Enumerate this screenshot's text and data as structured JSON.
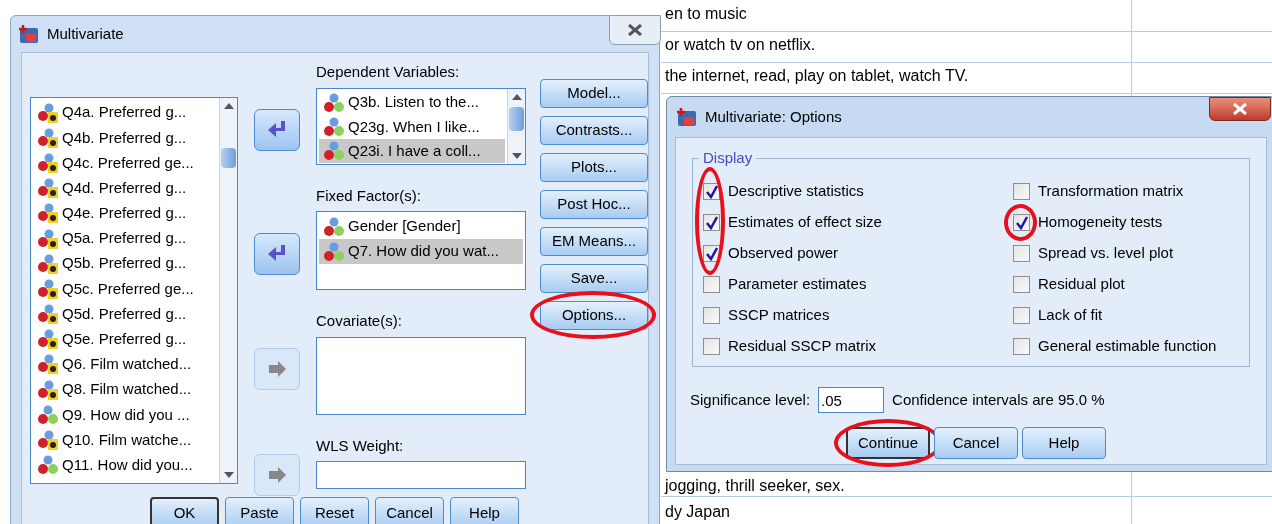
{
  "spreadsheet": {
    "rows": [
      {
        "text": "en to music"
      },
      {
        "text": "or watch tv on netflix."
      },
      {
        "text": "the internet, read, play on tablet, watch TV."
      },
      {
        "text": "jogging, thrill seeker, sex."
      },
      {
        "text": "dy Japan"
      }
    ]
  },
  "main_dialog": {
    "title": "Multivariate",
    "source_list": [
      {
        "label": "Q4a. Preferred g...",
        "kind": "string"
      },
      {
        "label": "Q4b. Preferred g...",
        "kind": "string"
      },
      {
        "label": "Q4c. Preferred ge...",
        "kind": "string"
      },
      {
        "label": "Q4d. Preferred g...",
        "kind": "string"
      },
      {
        "label": "Q4e. Preferred g...",
        "kind": "string"
      },
      {
        "label": "Q5a. Preferred g...",
        "kind": "string"
      },
      {
        "label": "Q5b. Preferred g...",
        "kind": "string"
      },
      {
        "label": "Q5c. Preferred ge...",
        "kind": "string"
      },
      {
        "label": "Q5d. Preferred g...",
        "kind": "string"
      },
      {
        "label": "Q5e. Preferred g...",
        "kind": "string"
      },
      {
        "label": "Q6. Film watched...",
        "kind": "string"
      },
      {
        "label": "Q8. Film watched...",
        "kind": "string"
      },
      {
        "label": "Q9. How did you ...",
        "kind": "numeric"
      },
      {
        "label": "Q10. Film watche...",
        "kind": "string"
      },
      {
        "label": "Q11. How did you...",
        "kind": "numeric"
      }
    ],
    "targets": [
      {
        "label": "Dependent Variables:",
        "arrow_disabled": false,
        "items": [
          {
            "label": "Q3b. Listen to the...",
            "kind": "numeric",
            "selected": false
          },
          {
            "label": "Q23g. When I like...",
            "kind": "numeric",
            "selected": false
          },
          {
            "label": "Q23i. I have a coll...",
            "kind": "numeric",
            "selected": true
          }
        ]
      },
      {
        "label": "Fixed Factor(s):",
        "arrow_disabled": false,
        "items": [
          {
            "label": "Gender   [Gender]",
            "kind": "numeric",
            "selected": false
          },
          {
            "label": "Q7. How did you wat...",
            "kind": "numeric",
            "selected": true
          }
        ]
      },
      {
        "label": "Covariate(s):",
        "arrow_disabled": true
      },
      {
        "label": "WLS Weight:",
        "arrow_disabled": true
      }
    ],
    "side_buttons": [
      {
        "label": "Model...",
        "circled": false
      },
      {
        "label": "Contrasts...",
        "circled": false
      },
      {
        "label": "Plots...",
        "circled": false
      },
      {
        "label": "Post Hoc...",
        "circled": false
      },
      {
        "label": "EM Means...",
        "circled": false
      },
      {
        "label": "Save...",
        "circled": false
      },
      {
        "label": "Options...",
        "circled": true
      }
    ],
    "bottom_buttons": [
      {
        "label": "OK",
        "default": true
      },
      {
        "label": "Paste",
        "default": false
      },
      {
        "label": "Reset",
        "default": false
      },
      {
        "label": "Cancel",
        "default": false
      },
      {
        "label": "Help",
        "default": false
      }
    ]
  },
  "options_dialog": {
    "title": "Multivariate: Options",
    "group_label": "Display",
    "left_options": [
      {
        "label": "Descriptive statistics",
        "checked": true
      },
      {
        "label": "Estimates of effect size",
        "checked": true
      },
      {
        "label": "Observed power",
        "checked": true
      },
      {
        "label": "Parameter estimates",
        "checked": false
      },
      {
        "label": "SSCP matrices",
        "checked": false
      },
      {
        "label": "Residual SSCP matrix",
        "checked": false
      }
    ],
    "left_circled": true,
    "right_options": [
      {
        "label": "Transformation matrix",
        "checked": false,
        "circled": false
      },
      {
        "label": "Homogeneity tests",
        "checked": true,
        "circled": true
      },
      {
        "label": "Spread vs. level plot",
        "checked": false,
        "circled": false
      },
      {
        "label": "Residual plot",
        "checked": false,
        "circled": false
      },
      {
        "label": "Lack of fit",
        "checked": false,
        "circled": false
      },
      {
        "label": "General estimable function",
        "checked": false,
        "circled": false
      }
    ],
    "significance_label": "Significance level:",
    "significance_value": ".05",
    "confidence_text": "Confidence intervals are 95.0 %",
    "buttons": [
      {
        "label": "Continue",
        "default": true,
        "circled": true
      },
      {
        "label": "Cancel",
        "default": false,
        "circled": false
      },
      {
        "label": "Help",
        "default": false,
        "circled": false
      }
    ]
  }
}
